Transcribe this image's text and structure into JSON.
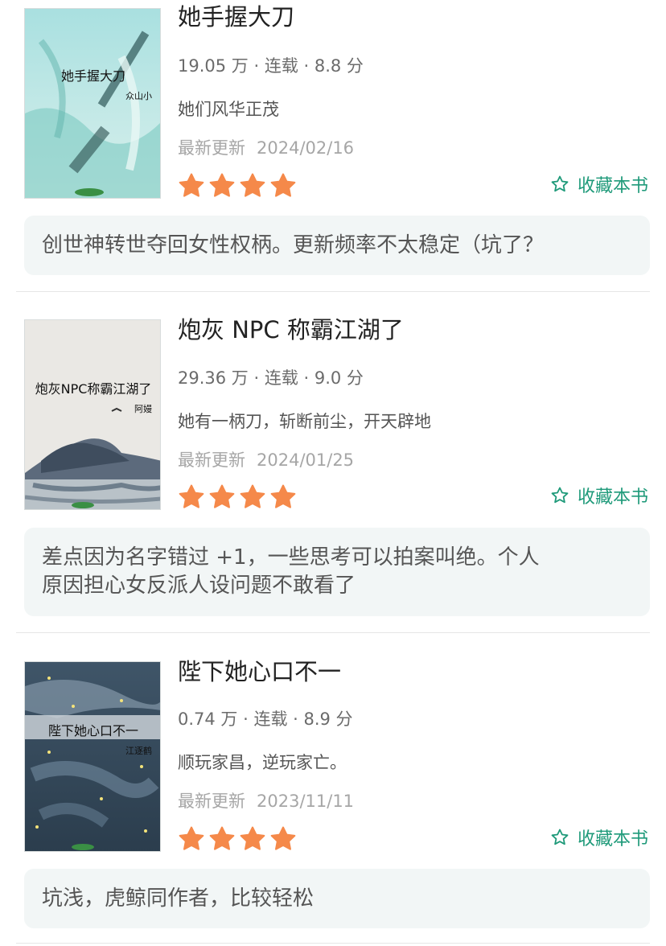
{
  "books": [
    {
      "cover_title": "她手握大刀",
      "cover_author": "众山小",
      "title": "她手握大刀",
      "meta": "19.05 万 · 连载 · 8.8 分",
      "intro": "她们风华正茂",
      "update_label": "最新更新",
      "update_date": "2024/02/16",
      "rating_stars": 4,
      "fav_label": "收藏本书",
      "comment": "创世神转世夺回女性权柄。更新频率不太稳定（坑了？"
    },
    {
      "cover_title": "炮灰NPC称霸江湖了",
      "cover_author": "阿嫚",
      "title": "炮灰 NPC 称霸江湖了",
      "meta": "29.36 万 · 连载 · 9.0 分",
      "intro": "她有一柄刀，斩断前尘，开天辟地",
      "update_label": "最新更新",
      "update_date": "2024/01/25",
      "rating_stars": 4,
      "fav_label": "收藏本书",
      "comment": "差点因为名字错过 +1，一些思考可以拍案叫绝。个人\n原因担心女反派人设问题不敢看了"
    },
    {
      "cover_title": "陛下她心口不一",
      "cover_author": "江逐鹤",
      "title": "陛下她心口不一",
      "meta": "0.74 万 · 连载 · 8.9 分",
      "intro": "顺玩家昌，逆玩家亡。",
      "update_label": "最新更新",
      "update_date": "2023/11/11",
      "rating_stars": 4,
      "fav_label": "收藏本书",
      "comment": "坑浅，虎鲸同作者，比较轻松"
    }
  ],
  "colors": {
    "star": "#f5894a",
    "accent": "#1f9a7a",
    "comment_bg": "#f2f6f6"
  },
  "icons": {
    "rating": "star-icon",
    "favorite": "star-outline-icon"
  }
}
